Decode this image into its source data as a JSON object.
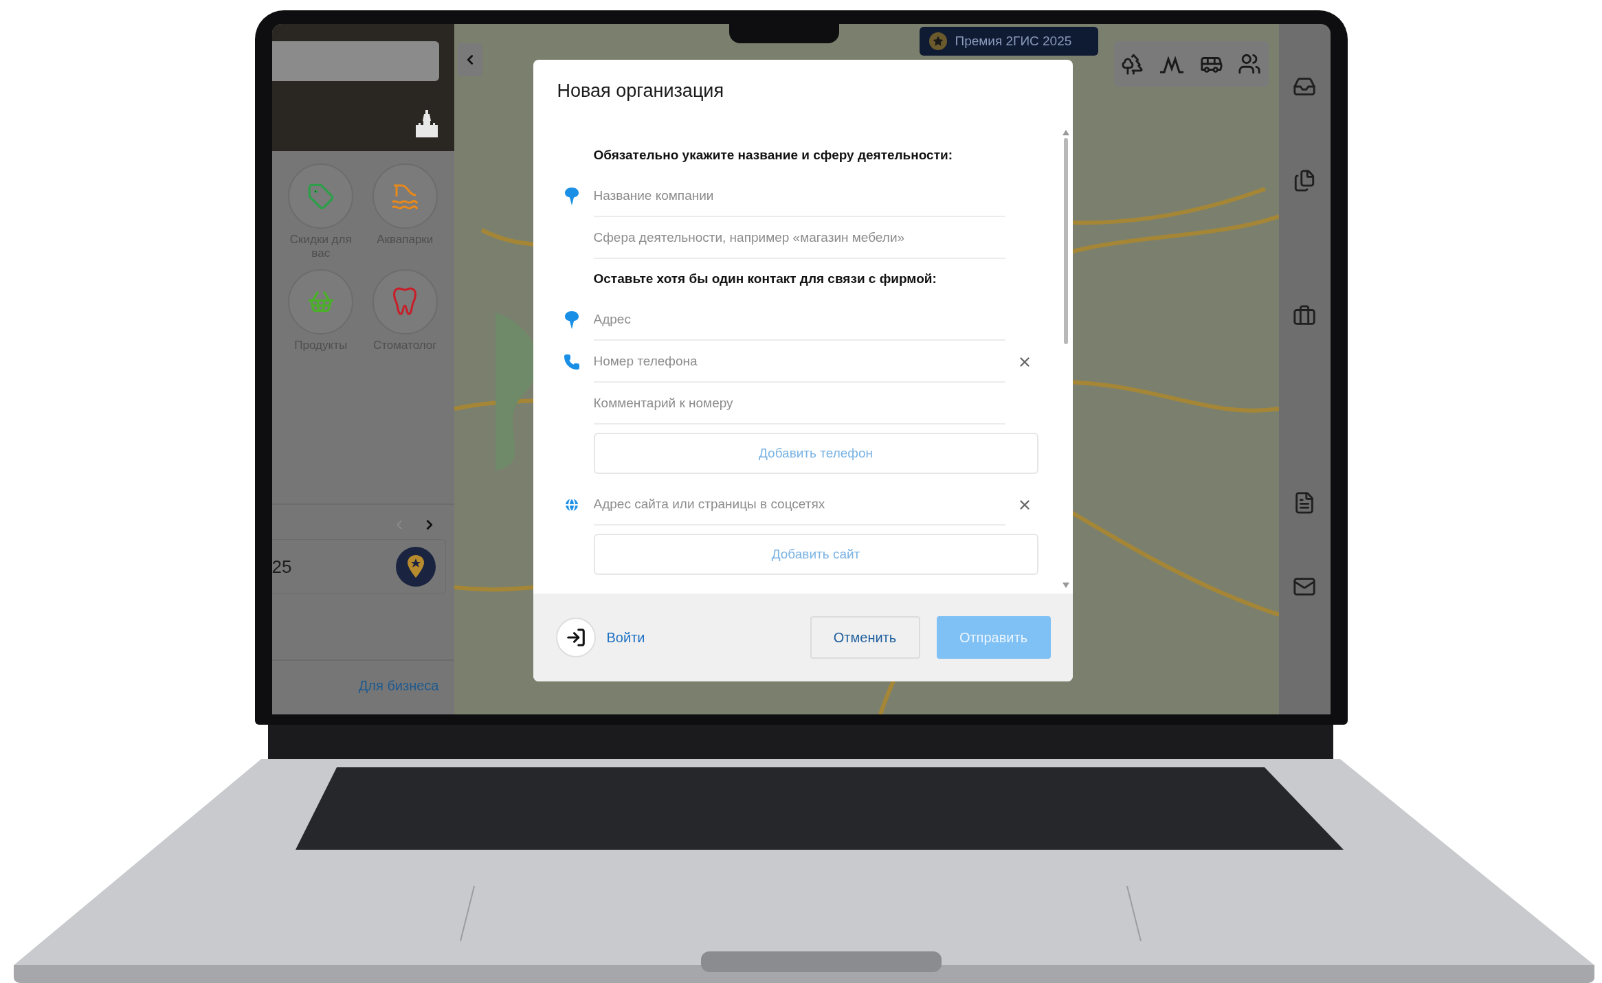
{
  "sidebar": {
    "categories": [
      {
        "label": "Скидки для вас",
        "color": "#2e9e4a"
      },
      {
        "label": "Аквапарки",
        "color": "#e8891a"
      },
      {
        "label": "Продукты",
        "color": "#4caf2a"
      },
      {
        "label": "Стоматолог",
        "color": "#c81e28"
      }
    ],
    "card": {
      "text": "25"
    },
    "footer_link": "Для бизнеса"
  },
  "map": {
    "banner": "Премия 2ГИС 2025"
  },
  "modal": {
    "title": "Новая организация",
    "items": [
      {
        "kind": "heading",
        "text": "Обязательно укажите название и сферу деятельности:"
      },
      {
        "kind": "place_field",
        "placeholder": "Название компании",
        "clearable": false
      },
      {
        "kind": "field",
        "placeholder": "Сфера деятельности, например «магазин мебели»",
        "clearable": false
      },
      {
        "kind": "heading",
        "text": "Оставьте хотя бы один контакт для связи с фирмой:"
      },
      {
        "kind": "place_field",
        "placeholder": "Адрес",
        "clearable": false
      },
      {
        "kind": "phone_field",
        "placeholder": "Номер телефона",
        "clearable": true
      },
      {
        "kind": "field",
        "placeholder": "Комментарий к номеру",
        "clearable": false
      },
      {
        "kind": "add_button",
        "label": "Добавить телефон"
      },
      {
        "kind": "web_field",
        "placeholder": "Адрес сайта или страницы в соцсетях",
        "clearable": true
      },
      {
        "kind": "add_button",
        "label": "Добавить сайт"
      }
    ],
    "footer": {
      "login": "Войти",
      "cancel": "Отменить",
      "submit": {
        "label": "Отправить",
        "disabled": true
      }
    }
  }
}
